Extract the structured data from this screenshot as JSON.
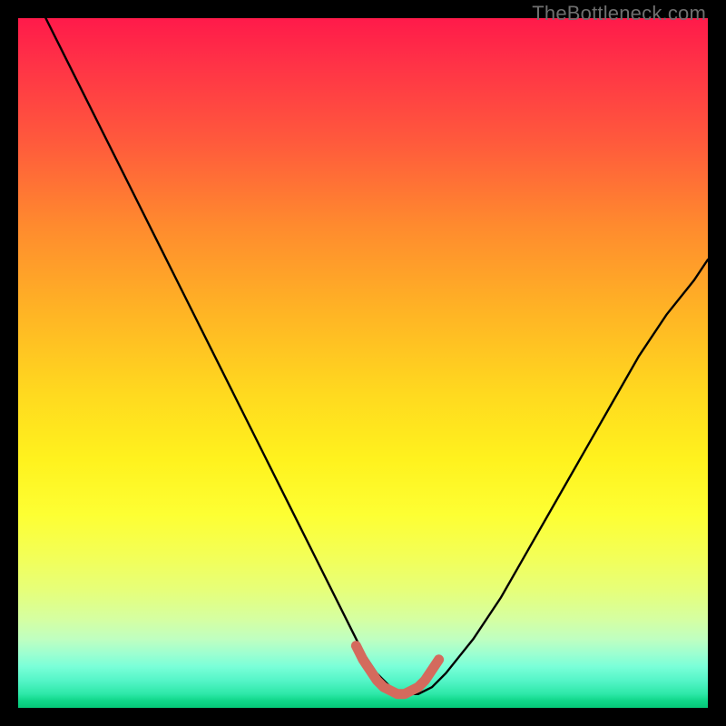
{
  "watermark": {
    "text": "TheBottleneck.com"
  },
  "colors": {
    "curve_stroke": "#000000",
    "highlight_stroke": "#d46a5d",
    "background": "#000000"
  },
  "chart_data": {
    "type": "line",
    "title": "",
    "xlabel": "",
    "ylabel": "",
    "xlim": [
      0,
      100
    ],
    "ylim": [
      0,
      100
    ],
    "grid": false,
    "legend": false,
    "series": [
      {
        "name": "curve",
        "x": [
          4,
          8,
          12,
          16,
          20,
          24,
          28,
          32,
          36,
          40,
          44,
          48,
          50,
          52,
          54,
          56,
          58,
          60,
          62,
          66,
          70,
          74,
          78,
          82,
          86,
          90,
          94,
          98,
          100
        ],
        "y": [
          100,
          92,
          84,
          76,
          68,
          60,
          52,
          44,
          36,
          28,
          20,
          12,
          8,
          5,
          3,
          2,
          2,
          3,
          5,
          10,
          16,
          23,
          30,
          37,
          44,
          51,
          57,
          62,
          65
        ]
      },
      {
        "name": "highlight",
        "x": [
          49,
          50,
          51,
          52,
          53,
          54,
          55,
          56,
          57,
          58,
          59,
          60,
          61
        ],
        "y": [
          9,
          7,
          5.5,
          4,
          3,
          2.5,
          2,
          2,
          2.5,
          3,
          4,
          5.5,
          7
        ]
      }
    ],
    "annotations": []
  }
}
